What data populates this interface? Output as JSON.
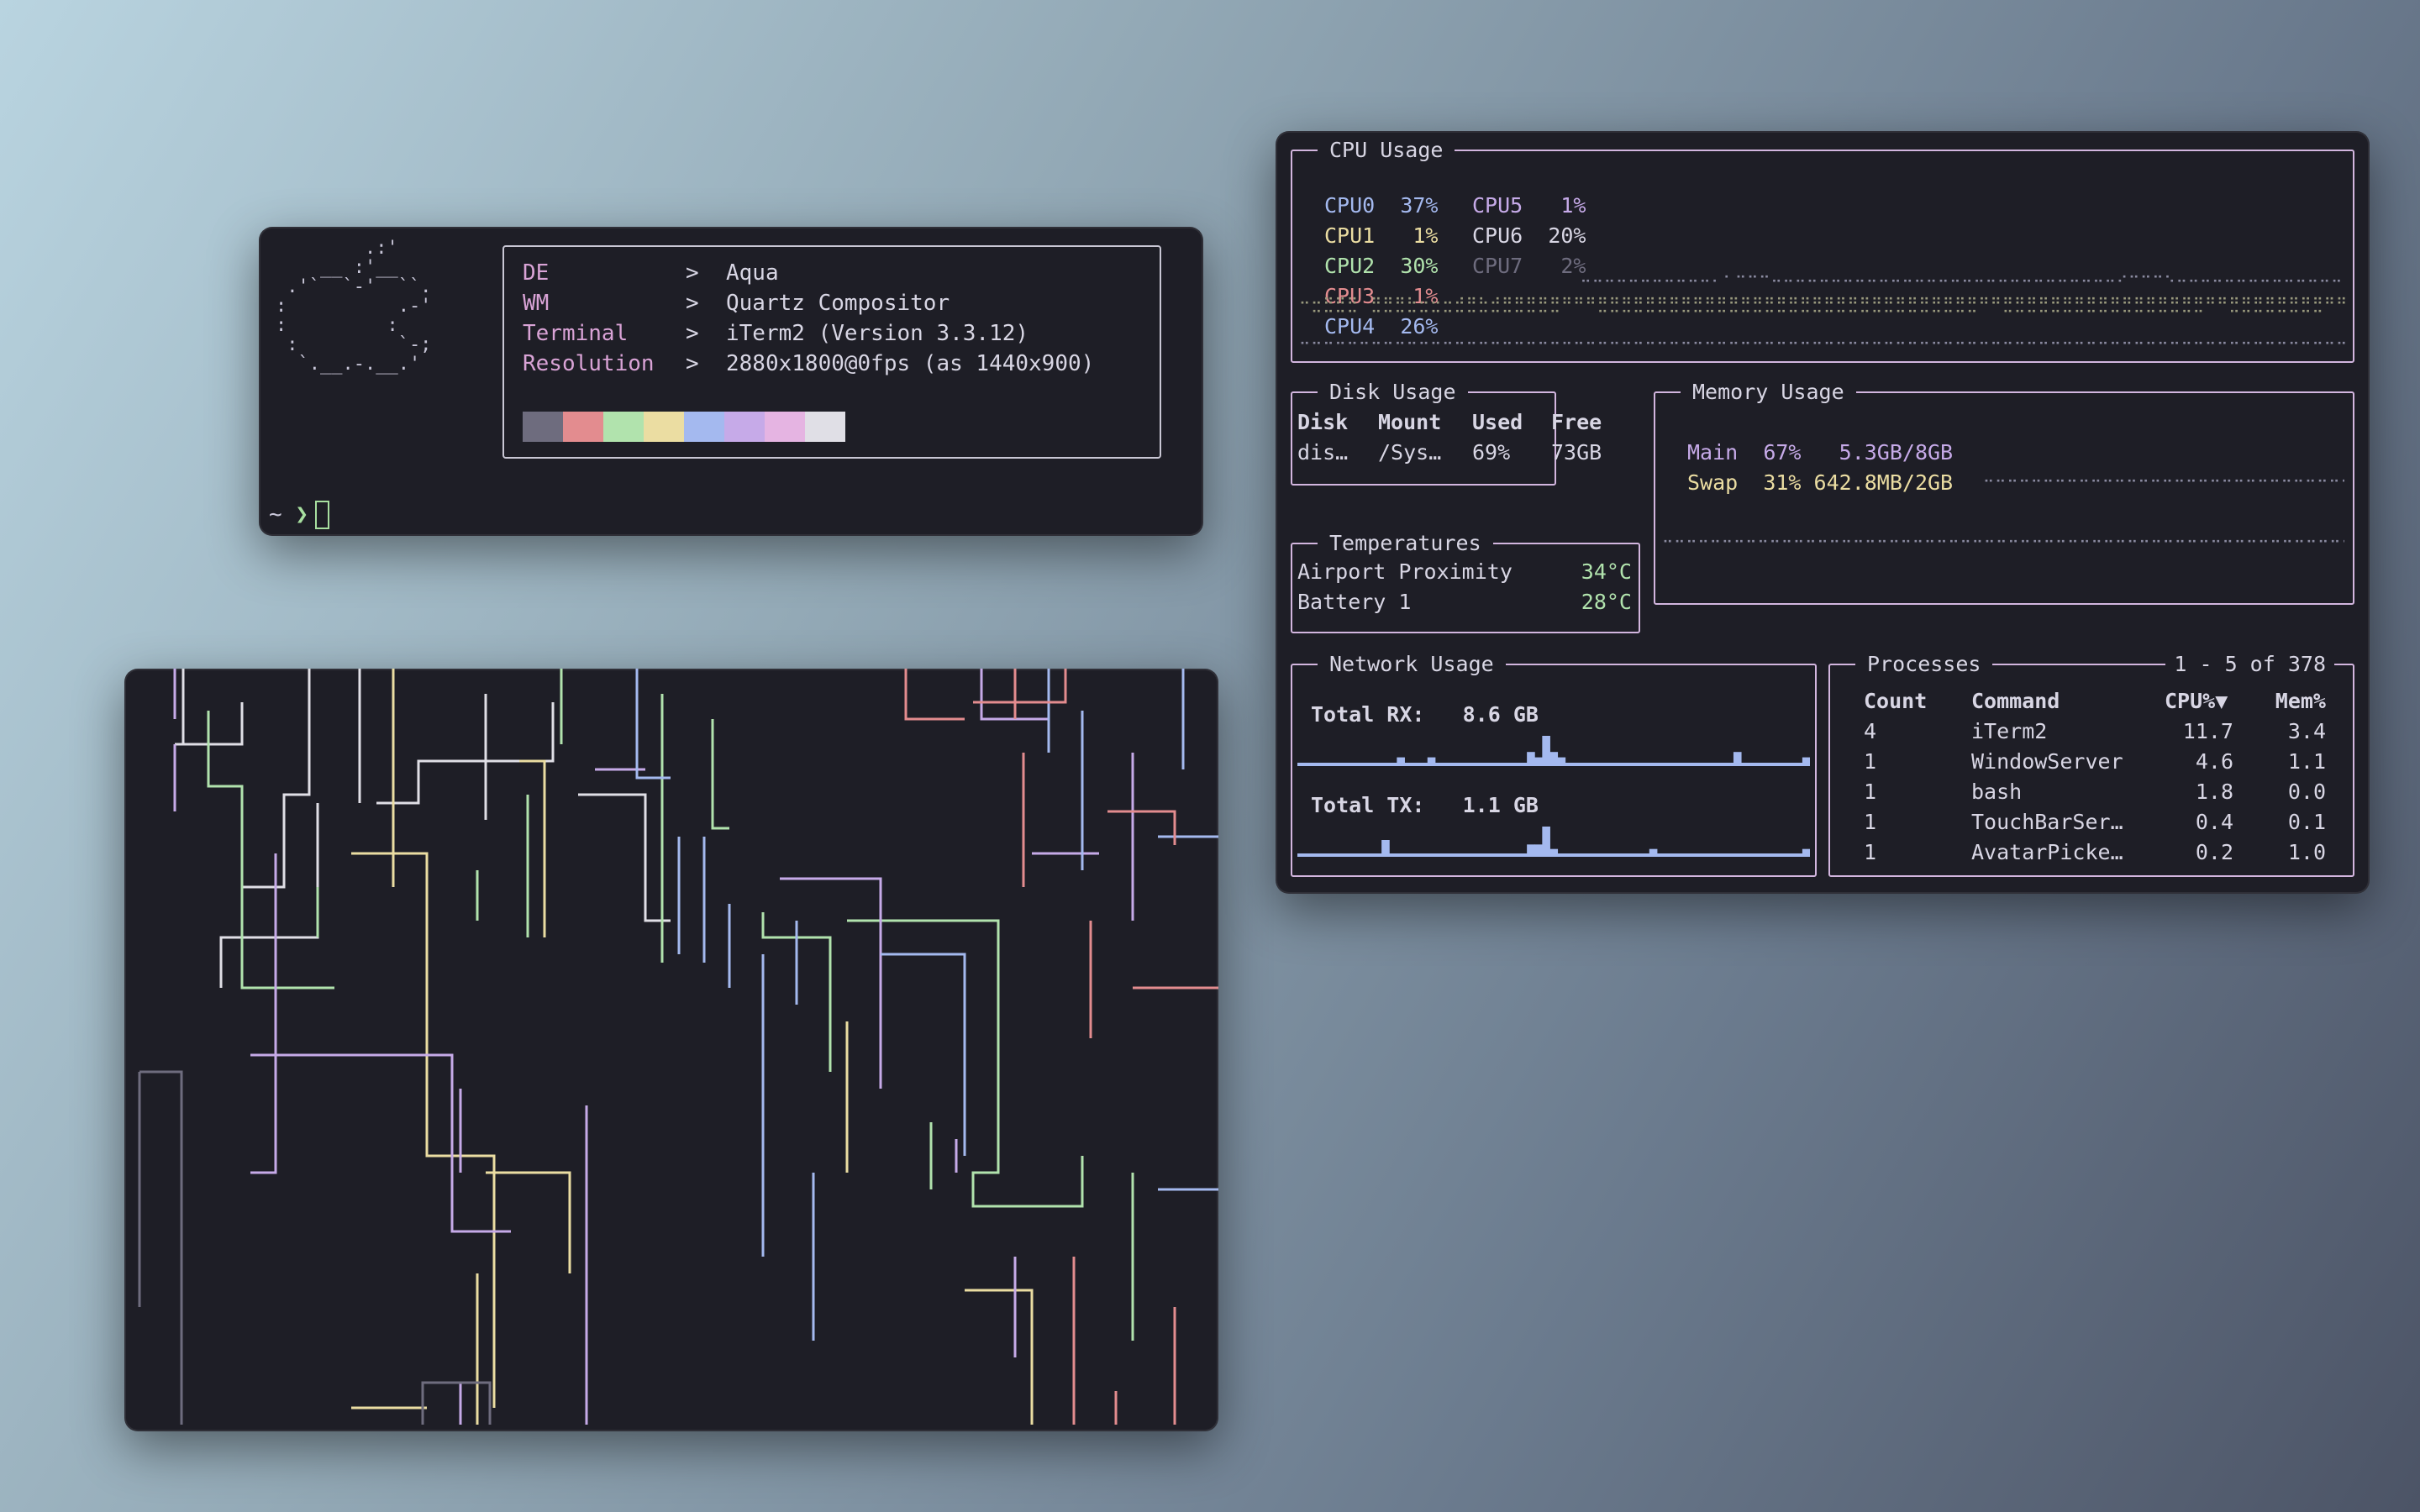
{
  "neofetch": {
    "ascii_logo": "        .:'\n    __ :'__\n .'`  `-'  ``.\n:          .-'\n:         :\n :         `-;\n  `.__.-.__.'",
    "info": [
      {
        "key": "DE",
        "sep": ">",
        "value": "Aqua"
      },
      {
        "key": "WM",
        "sep": ">",
        "value": "Quartz Compositor"
      },
      {
        "key": "Terminal",
        "sep": ">",
        "value": "iTerm2 (Version 3.3.12)"
      },
      {
        "key": "Resolution",
        "sep": ">",
        "value": "2880x1800@0fps (as 1440x900)"
      }
    ],
    "palette": [
      "#6e6c7e",
      "#e38c8f",
      "#b1e3ad",
      "#ebdda2",
      "#a4b9ef",
      "#c6aae8",
      "#e5b4e2",
      "#e0dfe6"
    ],
    "prompt": {
      "dir": "~",
      "symbol": "❯"
    }
  },
  "btm": {
    "cpu": {
      "title": "CPU Usage",
      "cores": [
        {
          "label": "CPU0",
          "value": "37%",
          "color": "#a4b9ef"
        },
        {
          "label": "CPU5",
          "value": "1%",
          "color": "#c6aae8"
        },
        {
          "label": "CPU1",
          "value": "1%",
          "color": "#ebdda2"
        },
        {
          "label": "CPU6",
          "value": "20%",
          "color": "#d8d6e4"
        },
        {
          "label": "CPU2",
          "value": "30%",
          "color": "#b1e3ad"
        },
        {
          "label": "CPU7",
          "value": "2%",
          "color": "#6e6c7e"
        },
        {
          "label": "CPU3",
          "value": "1%",
          "color": "#e38c8f"
        },
        {
          "label": "CPU4",
          "value": "26%",
          "color": "#a4b9ef"
        }
      ]
    },
    "disk": {
      "title": "Disk Usage",
      "headers": [
        "Disk",
        "Mount",
        "Used",
        "Free"
      ],
      "rows": [
        [
          "dis…",
          "/Sys…",
          "69%",
          "73GB"
        ]
      ]
    },
    "memory": {
      "title": "Memory Usage",
      "main": {
        "label": "Main",
        "pct": "67%",
        "amount": "5.3GB/8GB",
        "color": "#c6aae8"
      },
      "swap": {
        "label": "Swap",
        "pct": "31%",
        "amount": "642.8MB/2GB",
        "color": "#ebdda2"
      }
    },
    "temps": {
      "title": "Temperatures",
      "rows": [
        {
          "name": "Airport Proximity",
          "value": "34°C"
        },
        {
          "name": "Battery 1",
          "value": "28°C"
        }
      ],
      "value_color": "#b1e3ad"
    },
    "network": {
      "title": "Network Usage",
      "rx_label": "Total RX:",
      "rx_value": "8.6 GB",
      "tx_label": "Total TX:",
      "tx_value": "1.1 GB",
      "spark_color": "#a4b9ef",
      "rx_series": [
        0,
        0,
        0,
        0,
        0,
        0,
        0,
        0,
        0,
        0,
        0,
        0,
        0,
        1,
        0,
        0,
        0,
        1,
        0,
        0,
        0,
        0,
        0,
        0,
        0,
        0,
        0,
        0,
        0,
        0,
        2,
        1,
        5,
        2,
        1,
        0,
        0,
        0,
        0,
        0,
        0,
        0,
        0,
        0,
        0,
        0,
        0,
        0,
        0,
        0,
        0,
        0,
        0,
        0,
        0,
        0,
        0,
        2,
        0,
        0,
        0,
        0,
        0,
        0,
        0,
        0,
        1
      ],
      "tx_series": [
        0,
        0,
        0,
        0,
        0,
        0,
        0,
        0,
        0,
        0,
        0,
        3,
        0,
        0,
        0,
        0,
        0,
        0,
        0,
        0,
        0,
        0,
        0,
        0,
        0,
        0,
        0,
        0,
        0,
        0,
        2,
        2,
        6,
        1,
        0,
        0,
        0,
        0,
        0,
        0,
        0,
        0,
        0,
        0,
        0,
        0,
        1,
        0,
        0,
        0,
        0,
        0,
        0,
        0,
        0,
        0,
        0,
        0,
        0,
        0,
        0,
        0,
        0,
        0,
        0,
        0,
        1
      ]
    },
    "processes": {
      "title": "Processes",
      "range": "1 - 5 of 378",
      "headers": [
        "Count",
        "Command",
        "CPU%▼",
        "Mem%"
      ],
      "rows": [
        [
          "4",
          "iTerm2",
          "11.7",
          "3.4"
        ],
        [
          "1",
          "WindowServer",
          "4.6",
          "1.1"
        ],
        [
          "1",
          "bash",
          "1.8",
          "0.0"
        ],
        [
          "1",
          "TouchBarSer…",
          "0.4",
          "0.1"
        ],
        [
          "1",
          "AvatarPicke…",
          "0.2",
          "1.0"
        ]
      ]
    }
  }
}
